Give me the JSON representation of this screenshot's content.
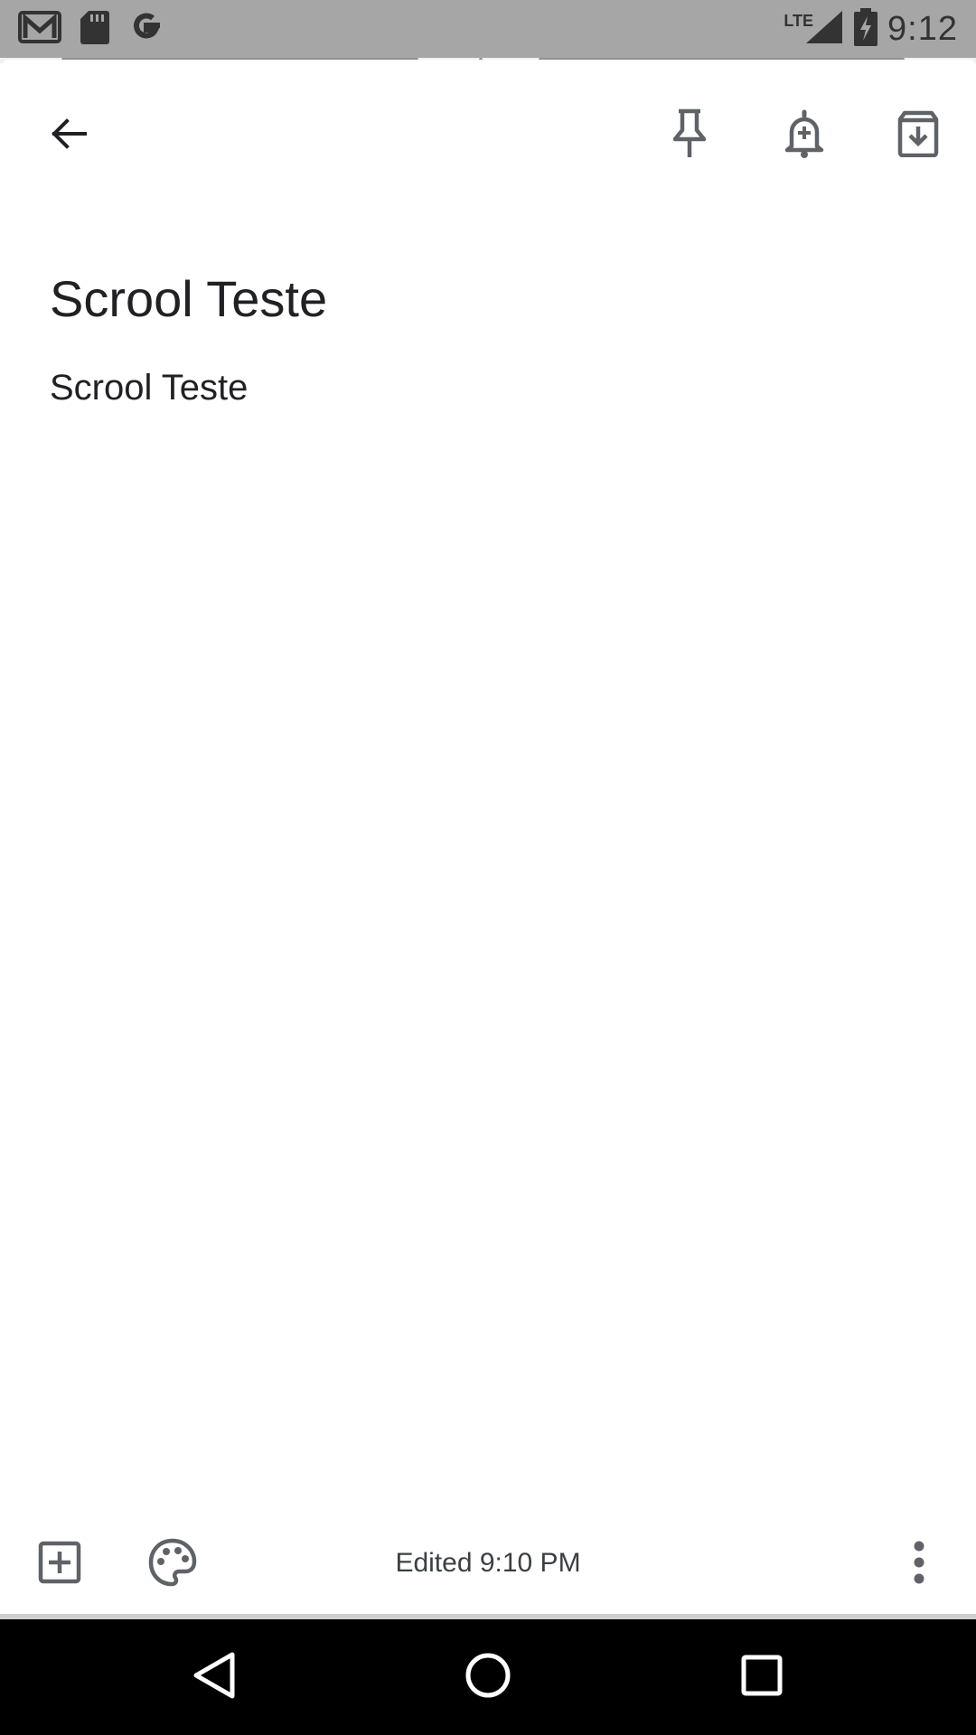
{
  "status_bar": {
    "time": "9:12",
    "network_label": "LTE",
    "left_icons": [
      "gmail-icon",
      "sd-card-icon",
      "google-icon"
    ],
    "right_icons": [
      "signal-icon",
      "battery-charging-icon"
    ]
  },
  "toolbar": {
    "back_icon": "arrow-back-icon",
    "pin_icon": "pin-icon",
    "reminder_icon": "add-reminder-icon",
    "archive_icon": "archive-icon"
  },
  "note": {
    "title": "Scrool Teste",
    "body": "Scrool Teste"
  },
  "bottom_bar": {
    "add_icon": "add-box-icon",
    "palette_icon": "palette-icon",
    "edited_label": "Edited 9:10 PM",
    "more_icon": "more-vert-icon"
  },
  "nav_bar": {
    "back": "nav-back-icon",
    "home": "nav-home-icon",
    "recents": "nav-recents-icon"
  },
  "colors": {
    "status_bar": "#a6a6a6",
    "icon": "#5f6368",
    "text": "#202124",
    "nav_bar": "#000000"
  }
}
